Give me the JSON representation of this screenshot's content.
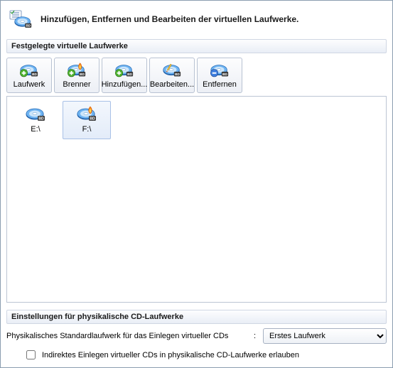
{
  "header": {
    "title": "Hinzufügen, Entfernen und Bearbeiten der virtuellen Laufwerke."
  },
  "section_drives_title": "Festgelegte virtuelle Laufwerke",
  "toolbar": {
    "drive": "Laufwerk",
    "burner": "Brenner",
    "add": "Hinzufügen...",
    "edit": "Bearbeiten...",
    "remove": "Entfernen"
  },
  "drives": [
    {
      "label": "E:\\",
      "burner": false,
      "selected": false
    },
    {
      "label": "F:\\",
      "burner": true,
      "selected": true
    }
  ],
  "section_physical_title": "Einstellungen für physikalische CD-Laufwerke",
  "physical": {
    "default_label": "Physikalisches Standardlaufwerk für das Einlegen virtueller CDs",
    "default_value": "Erstes Laufwerk",
    "indirect_label": "Indirektes Einlegen virtueller CDs in physikalische CD-Laufwerke erlauben",
    "indirect_checked": false
  }
}
